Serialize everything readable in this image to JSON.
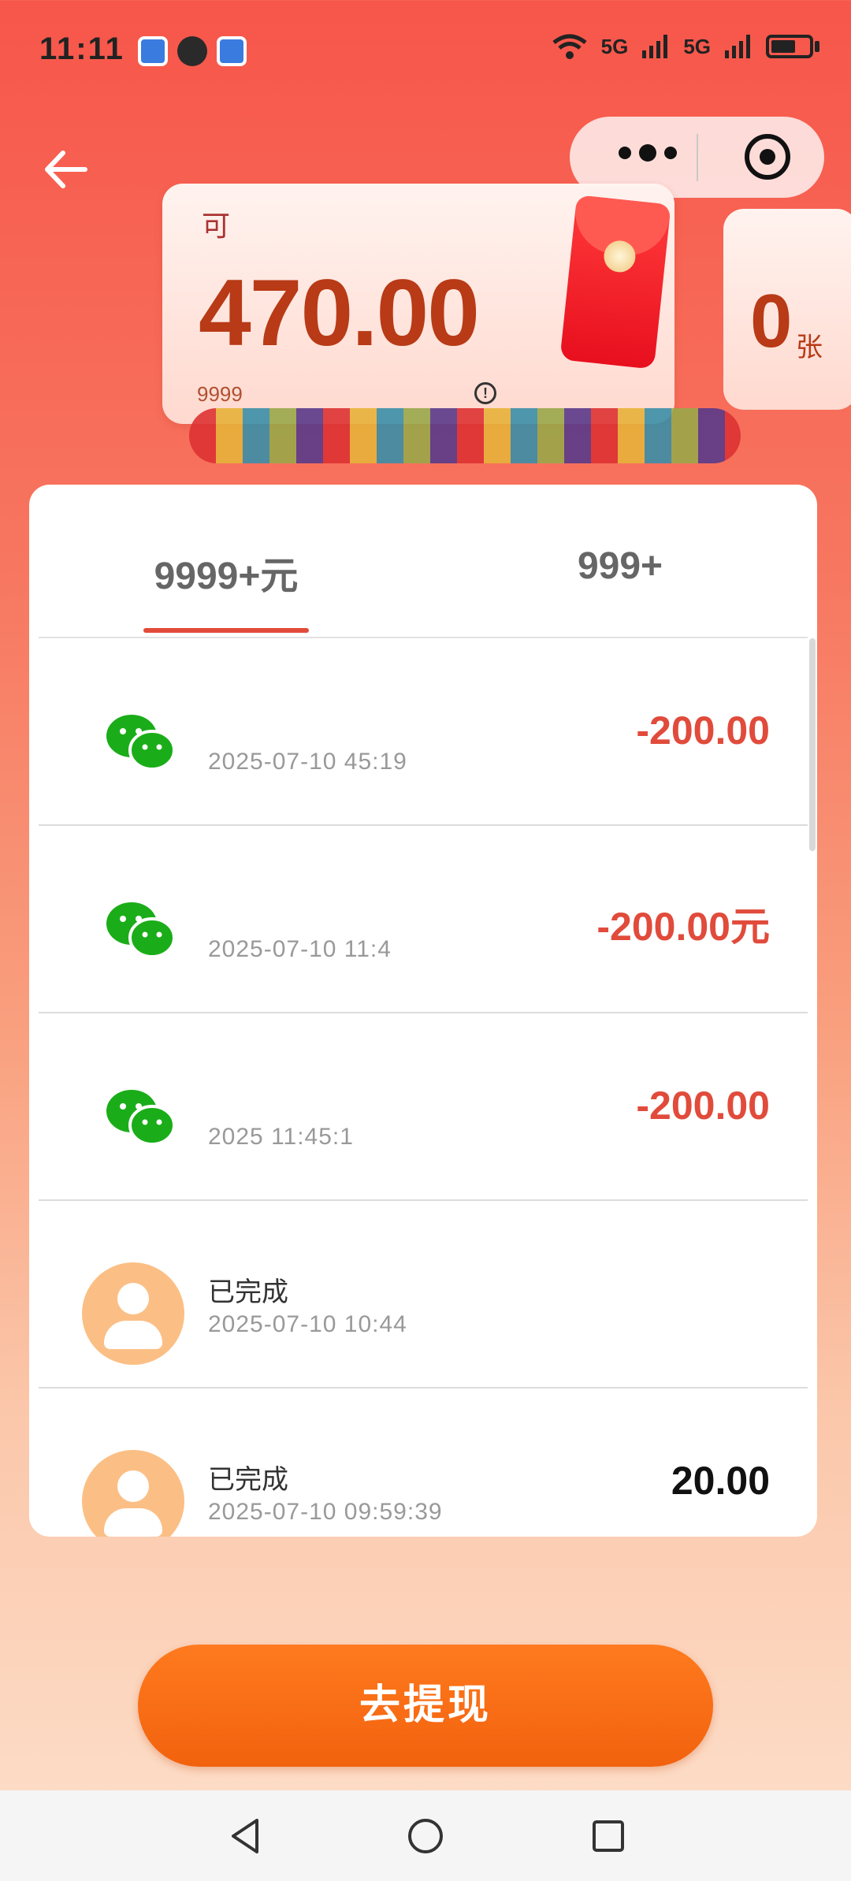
{
  "status_bar": {
    "time": "11:11",
    "signal_1": "5G",
    "signal_2": "5G"
  },
  "header": {
    "back_icon": "arrow-left-icon",
    "more_icon": "more-dots-icon",
    "close_icon": "target-circle-icon"
  },
  "balance": {
    "label": "可",
    "amount": "470.00",
    "total_text": "9999",
    "info_icon": "!"
  },
  "coupon": {
    "label": "",
    "count": "0",
    "unit": "张"
  },
  "tabs": [
    {
      "label": "",
      "value": "9999+元"
    },
    {
      "label": "",
      "value": "999+"
    }
  ],
  "records": [
    {
      "type": "wechat",
      "title": "",
      "time": "2025-07-10    45:19",
      "amount": "-200.00",
      "status": ""
    },
    {
      "type": "wechat",
      "title": "",
      "time": "2025-07-10 11:4",
      "amount": "-200.00元",
      "status": ""
    },
    {
      "type": "wechat",
      "title": "",
      "time": "2025    11:45:1",
      "amount": "-200.00",
      "status": ""
    },
    {
      "type": "user",
      "title": "已完成",
      "time": "2025-07-10 10:44",
      "amount": "",
      "status": ""
    },
    {
      "type": "user",
      "title": "已完成",
      "time": "2025-07-10 09:59:39",
      "amount": "20.00",
      "status": ""
    }
  ],
  "actions": {
    "withdraw_label": "去提现"
  },
  "colors": {
    "accent": "#f2620e",
    "negative": "#e14b3b",
    "wechat_green": "#1aad19"
  }
}
